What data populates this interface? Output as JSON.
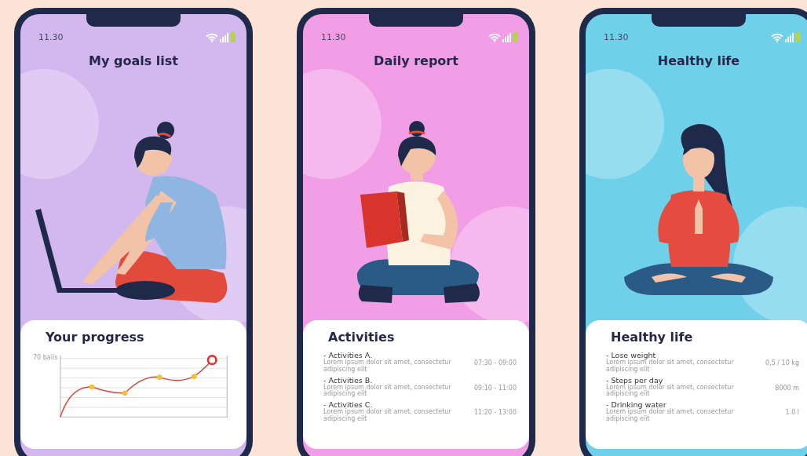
{
  "phones": [
    {
      "time": "11.30",
      "title": "My goals list",
      "color": "#d3b8f0",
      "kind": "laptop",
      "card": {
        "kind": "chart",
        "title": "Your progress",
        "ylabel": "70 bails"
      }
    },
    {
      "time": "11.30",
      "title": "Daily report",
      "color": "#f29ee6",
      "kind": "reading",
      "card": {
        "kind": "list",
        "title": "Activities",
        "items": [
          {
            "label": "- Activities A.",
            "text": "Lorem ipsum dolor sit amet, consectetur adipiscing elit",
            "value": "07:30 - 09:00"
          },
          {
            "label": "- Activities B.",
            "text": "Lorem ipsum dolor sit amet, consectetur adipiscing elit",
            "value": "09:10 - 11:00"
          },
          {
            "label": "- Activities C.",
            "text": "Lorem ipsum dolor sit amet, consectetur adipiscing elit",
            "value": "11:20 - 13:00"
          }
        ]
      }
    },
    {
      "time": "11.30",
      "title": "Healthy life",
      "color": "#6fd0ea",
      "kind": "yoga",
      "card": {
        "kind": "list",
        "title": "Healthy life",
        "items": [
          {
            "label": "- Lose weight",
            "text": "Lorem ipsum dolor sit amet, consectetur adipiscing elit",
            "value": "0,5 / 10 kg"
          },
          {
            "label": "- Steps per day",
            "text": "Lorem ipsum dolor sit amet, consectetur adipiscing elit",
            "value": "8000 m"
          },
          {
            "label": "- Drinking water",
            "text": "Lorem ipsum dolor sit amet, consectetur adipiscing elit",
            "value": "1.0 l"
          }
        ]
      }
    }
  ]
}
